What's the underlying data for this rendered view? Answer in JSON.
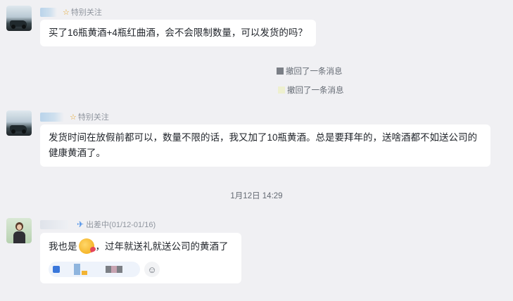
{
  "messages": [
    {
      "follow_label": "特别关注",
      "text": "买了16瓶黄酒+4瓶红曲酒，会不会限制数量，可以发货的吗？"
    },
    {
      "follow_label": "特别关注",
      "text": "发货时间在放假前都可以，数量不限的话，我又加了10瓶黄酒。总是要拜年的，送啥酒都不如送公司的健康黄酒了。"
    },
    {
      "status_label": "出差中(01/12-01/16)",
      "text_before": "我也是",
      "text_after": "，过年就送礼就送公司的黄酒了"
    }
  ],
  "recalls": [
    {
      "text": "撤回了一条消息"
    },
    {
      "text": "撤回了一条消息"
    }
  ],
  "timestamp": "1月12日 14:29",
  "colors": {
    "background": "#f0f0f3",
    "bubble": "#ffffff",
    "follow_star": "#e3a329",
    "status_plane": "#4c90e8"
  },
  "icons": {
    "follow": "star-icon",
    "status": "airplane-icon",
    "reaction_add": "add-reaction-icon"
  }
}
